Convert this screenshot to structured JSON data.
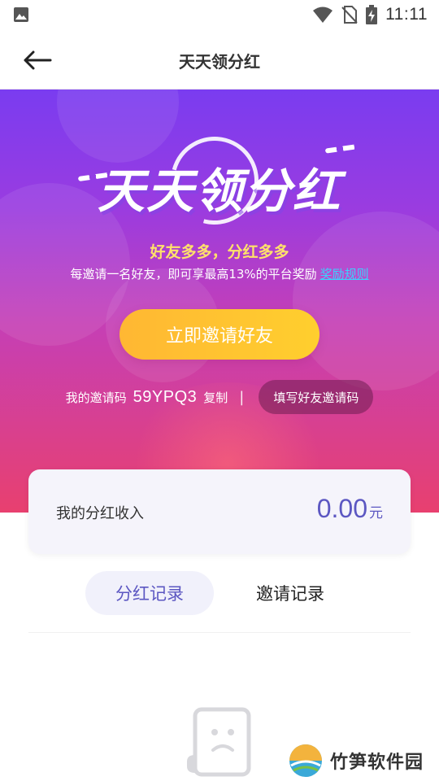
{
  "status_bar": {
    "time": "11:11",
    "icons": [
      "gallery-icon",
      "wifi-icon",
      "no-sim-icon",
      "battery-charging-icon"
    ]
  },
  "header": {
    "title": "天天领分红",
    "back_icon": "arrow-left-icon"
  },
  "hero": {
    "big_title": "天天领分红",
    "slogan": "好友多多，分红多多",
    "description": "每邀请一名好友，即可享最高13%的平台奖励",
    "rule_link": "奖励规则",
    "invite_button": "立即邀请好友",
    "code_label": "我的邀请码",
    "code_value": "59YPQ3",
    "copy_label": "复制",
    "separator": "|",
    "fill_code_button": "填写好友邀请码",
    "colors": {
      "gradient_top": "#7a3cf0",
      "gradient_bottom": "#e8406f",
      "slogan": "#ffe26a",
      "link": "#3ad3ff",
      "button": "#ffc22f"
    }
  },
  "income_card": {
    "label": "我的分红收入",
    "amount": "0.00",
    "unit": "元",
    "accent": "#5c57c2"
  },
  "tabs": [
    {
      "label": "分红记录",
      "active": true
    },
    {
      "label": "邀请记录",
      "active": false
    }
  ],
  "empty_state": {
    "icon": "empty-document-icon"
  },
  "watermark": {
    "text": "竹笋软件园",
    "logo": "zhusun-logo"
  }
}
